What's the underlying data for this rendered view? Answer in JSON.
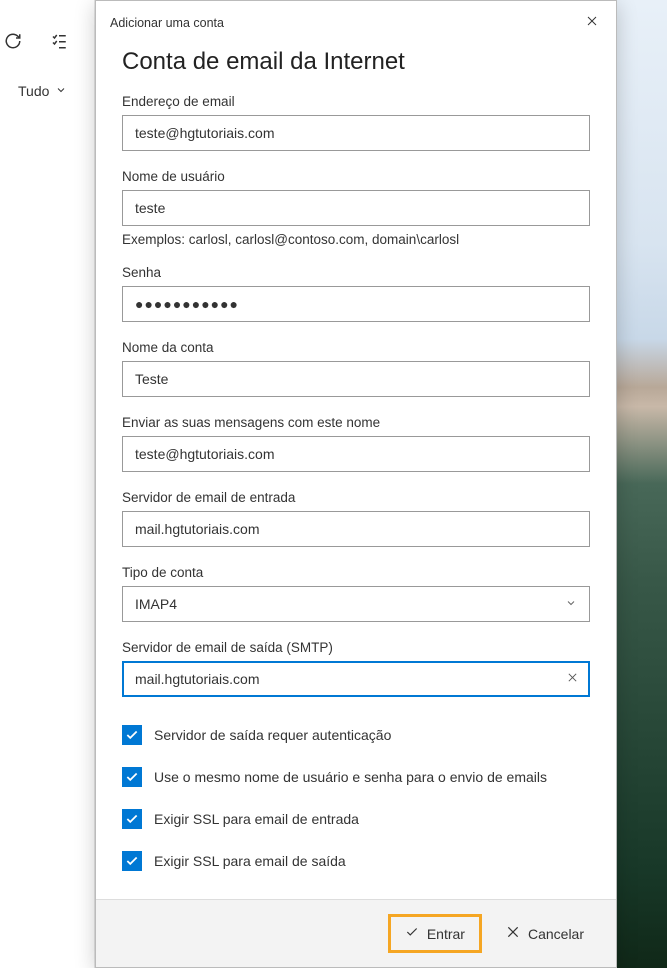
{
  "toolbar": {
    "filter_label": "Tudo"
  },
  "dialog": {
    "title": "Adicionar uma conta",
    "heading": "Conta de email da Internet",
    "fields": {
      "email": {
        "label": "Endereço de email",
        "value": "teste@hgtutoriais.com"
      },
      "username": {
        "label": "Nome de usuário",
        "value": "teste",
        "hint": "Exemplos: carlosl, carlosl@contoso.com, domain\\carlosl"
      },
      "password": {
        "label": "Senha",
        "value": "●●●●●●●●●●●"
      },
      "account_name": {
        "label": "Nome da conta",
        "value": "Teste"
      },
      "send_name": {
        "label": "Enviar as suas mensagens com este nome",
        "value": "teste@hgtutoriais.com"
      },
      "incoming_server": {
        "label": "Servidor de email de entrada",
        "value": "mail.hgtutoriais.com"
      },
      "account_type": {
        "label": "Tipo de conta",
        "value": "IMAP4"
      },
      "outgoing_server": {
        "label": "Servidor de email de saída (SMTP)",
        "value": "mail.hgtutoriais.com"
      }
    },
    "checkboxes": {
      "auth": "Servidor de saída requer autenticação",
      "same_creds": "Use o mesmo nome de usuário e senha para o envio de emails",
      "ssl_in": "Exigir SSL para email de entrada",
      "ssl_out": "Exigir SSL para email de saída"
    },
    "buttons": {
      "enter": "Entrar",
      "cancel": "Cancelar"
    }
  }
}
